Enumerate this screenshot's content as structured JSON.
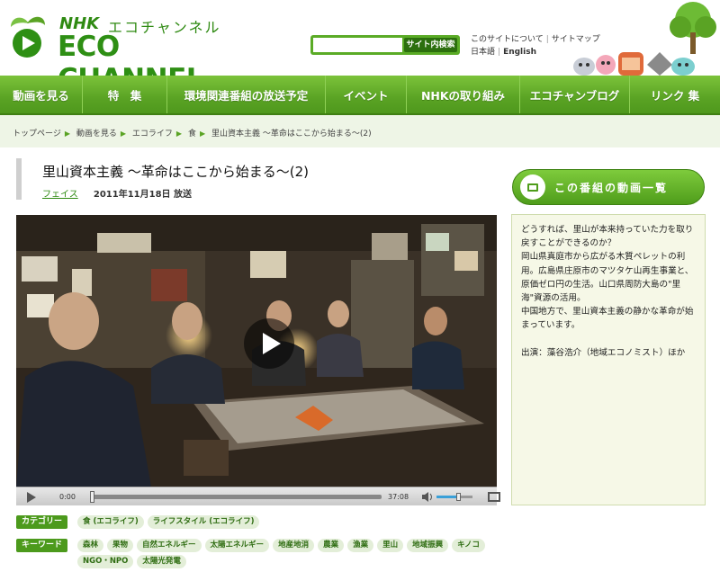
{
  "header": {
    "logo_nhk": "NHK",
    "logo_sub": "エコチャンネル",
    "logo_main": "ECO CHANNEL",
    "search": {
      "placeholder": "",
      "button": "サイト内検索"
    },
    "links": {
      "about": "このサイトについて",
      "sitemap": "サイトマップ",
      "japanese": "日本語",
      "english": "English"
    }
  },
  "nav": [
    "動画を見る",
    "特　集",
    "環境関連番組の放送予定",
    "イベント",
    "NHKの取り組み",
    "エコチャンブログ",
    "リンク 集"
  ],
  "breadcrumb": [
    "トップページ",
    "動画を見る",
    "エコライフ",
    "食",
    "里山資本主義 〜革命はここから始まる〜(2)"
  ],
  "title": "里山資本主義 〜革命はここから始まる〜(2)",
  "meta": {
    "tag": "フェイス",
    "date": "2011年11月18日 放送"
  },
  "player": {
    "current_time": "0:00",
    "duration": "37:08",
    "progress": 0.0,
    "volume": 0.6
  },
  "categories": {
    "label": "カテゴリー",
    "items": [
      "食 (エコライフ)",
      "ライフスタイル (エコライフ)"
    ]
  },
  "keywords": {
    "label": "キーワード",
    "items": [
      "森林",
      "果物",
      "自然エネルギー",
      "太陽エネルギー",
      "地産地消",
      "農業",
      "漁業",
      "里山",
      "地域振興",
      "キノコ",
      "NGO・NPO",
      "太陽光発電"
    ]
  },
  "sidebar": {
    "button": "この番組の動画一覧",
    "description": [
      "どうすれば、里山が本来持っていた力を取り戻すことができるのか？",
      "岡山県真庭市から広がる木質ペレットの利用。広島県庄原市のマツタケ山再生事業と、原価ゼロ円の生活。山口県周防大島の\"里海\"資源の活用。",
      "中国地方で、里山資本主義の静かな革命が始まっています。"
    ],
    "credit": "出演：藻谷浩介（地域エコノミスト）ほか"
  },
  "colors": {
    "brand_green": "#4f981d",
    "accent_green": "#7cc33a",
    "panel_bg": "#f6f8e7"
  }
}
